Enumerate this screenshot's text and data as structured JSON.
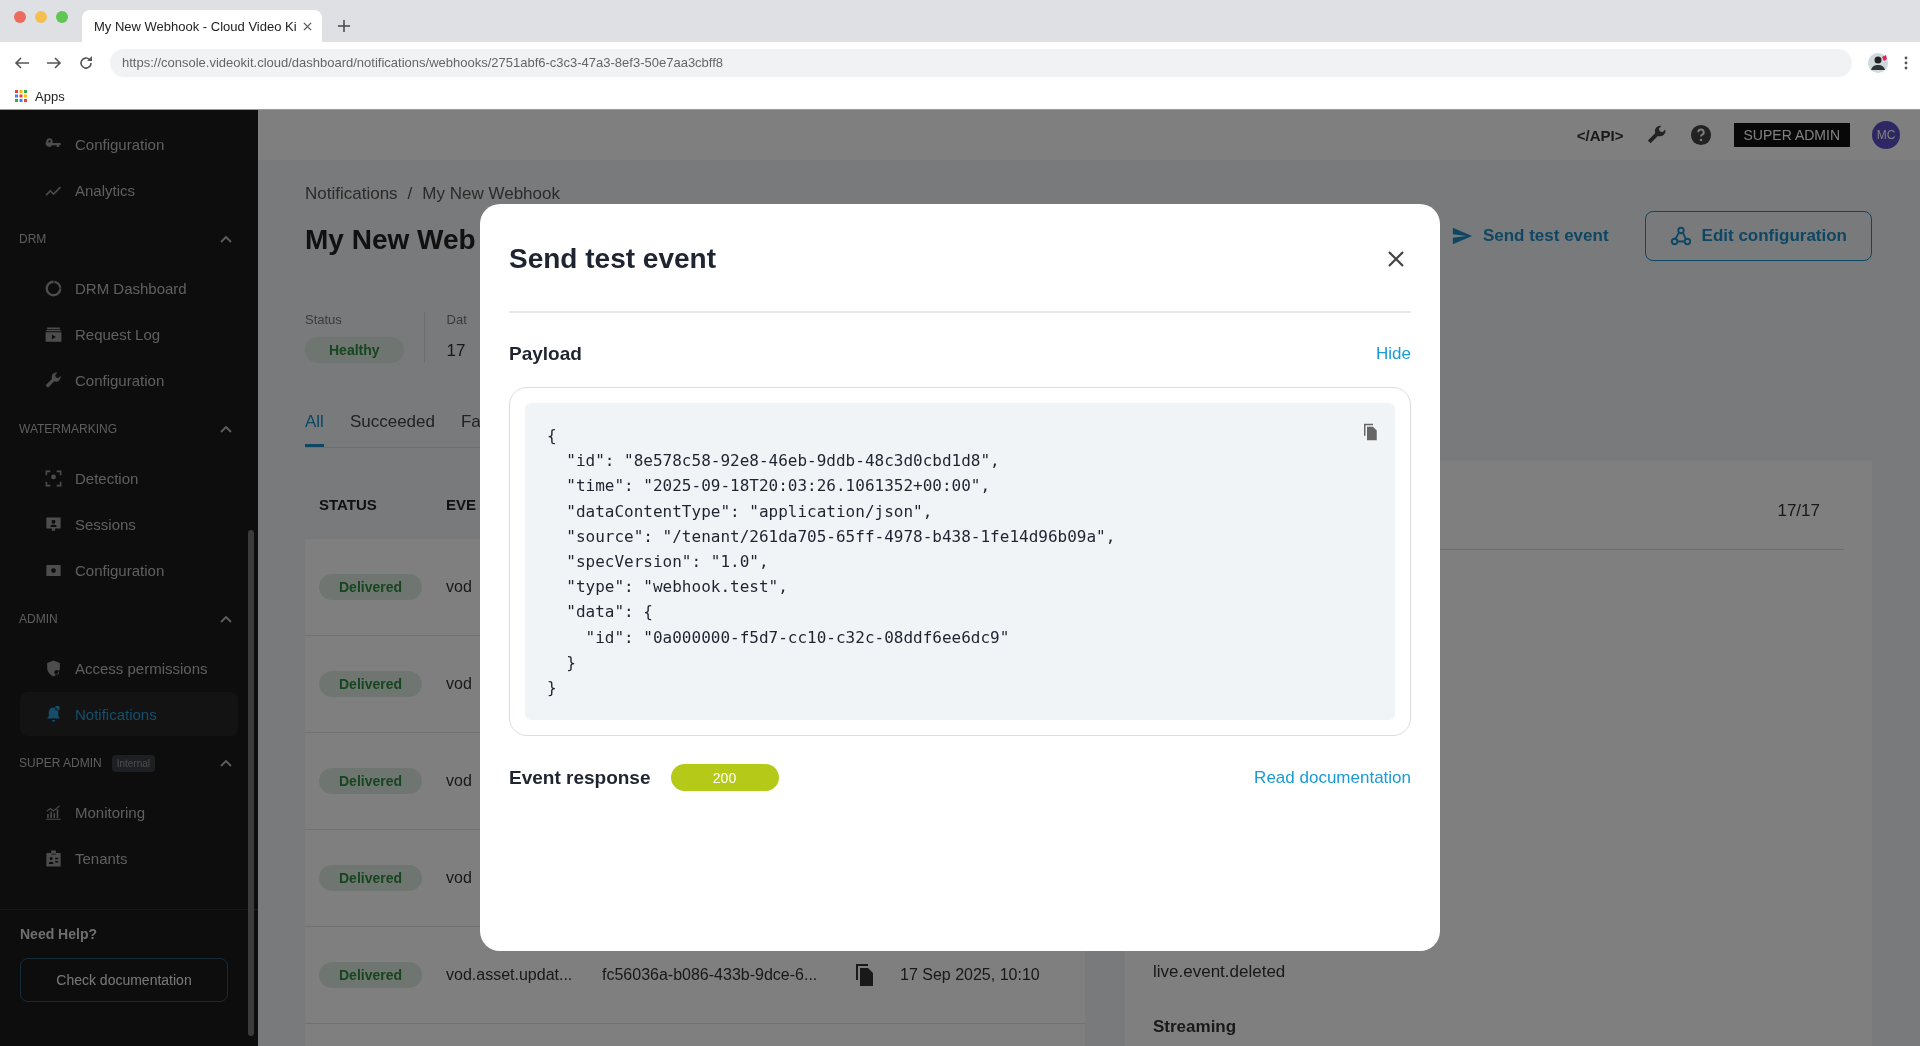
{
  "browser": {
    "tab_title": "My New Webhook - Cloud Video Ki",
    "url": "https://console.videokit.cloud/dashboard/notifications/webhooks/2751abf6-c3c3-47a3-8ef3-50e7aa3cbff8",
    "bookmarks": [
      "Apps"
    ]
  },
  "sidebar": {
    "groups": [
      {
        "items": [
          {
            "label": "Configuration",
            "selected": false
          },
          {
            "label": "Analytics",
            "selected": false
          }
        ]
      },
      {
        "title": "DRM",
        "expanded": true,
        "items": [
          {
            "label": "DRM Dashboard",
            "selected": false
          },
          {
            "label": "Request Log",
            "selected": false
          },
          {
            "label": "Configuration",
            "selected": false
          }
        ]
      },
      {
        "title": "WATERMARKING",
        "expanded": true,
        "items": [
          {
            "label": "Detection",
            "selected": false
          },
          {
            "label": "Sessions",
            "selected": false
          },
          {
            "label": "Configuration",
            "selected": false
          }
        ]
      },
      {
        "title": "ADMIN",
        "expanded": true,
        "items": [
          {
            "label": "Access permissions",
            "selected": false
          },
          {
            "label": "Notifications",
            "selected": true
          }
        ]
      },
      {
        "title": "SUPER ADMIN",
        "badge": "Internal",
        "expanded": true,
        "items": [
          {
            "label": "Monitoring",
            "selected": false
          },
          {
            "label": "Tenants",
            "selected": false
          }
        ]
      }
    ],
    "help_title": "Need Help?",
    "help_button": "Check documentation"
  },
  "topbar": {
    "api_label": "</API>",
    "role": "SUPER ADMIN",
    "avatar": "MC"
  },
  "page": {
    "breadcrumb": [
      "Notifications",
      "My New Webhook"
    ],
    "breadcrumb_separator": "/",
    "title": "My New Web",
    "send_button": "Send test event",
    "edit_button": "Edit configuration",
    "stats": [
      {
        "label": "Status",
        "value": "Healthy",
        "kind": "badge"
      },
      {
        "label": "Dat",
        "value": "17",
        "kind": "text"
      }
    ],
    "tabs": [
      {
        "label": "All",
        "selected": true
      },
      {
        "label": "Succeeded",
        "selected": false
      },
      {
        "label": "Fa",
        "selected": false
      }
    ],
    "table": {
      "columns": [
        "STATUS",
        "EVE"
      ],
      "rows": [
        {
          "status": "Delivered",
          "event": "vod"
        },
        {
          "status": "Delivered",
          "event": "vod"
        },
        {
          "status": "Delivered",
          "event": "vod"
        },
        {
          "status": "Delivered",
          "event": "vod"
        },
        {
          "status": "Delivered",
          "event": "vod.asset.updat...",
          "id": "fc56036a-b086-433b-9dce-6...",
          "date": "17 Sep 2025, 10:10"
        }
      ]
    },
    "side_panel": {
      "count": "17/17",
      "event": "live.event.deleted",
      "section": "Streaming"
    }
  },
  "modal": {
    "title": "Send test event",
    "payload_label": "Payload",
    "toggle": "Hide",
    "payload_lines": [
      "{",
      "  \"id\": \"8e578c58-92e8-46eb-9ddb-48c3d0cbd1d8\",",
      "  \"time\": \"2025-09-18T20:03:26.1061352+00:00\",",
      "  \"dataContentType\": \"application/json\",",
      "  \"source\": \"/tenant/261da705-65ff-4978-b438-1fe14d96b09a\",",
      "  \"specVersion\": \"1.0\",",
      "  \"type\": \"webhook.test\",",
      "  \"data\": {",
      "    \"id\": \"0a000000-f5d7-cc10-c32c-08ddf6ee6dc9\"",
      "  }",
      "}"
    ],
    "response_label": "Event response",
    "response_code": "200",
    "docs_link": "Read documentation"
  }
}
